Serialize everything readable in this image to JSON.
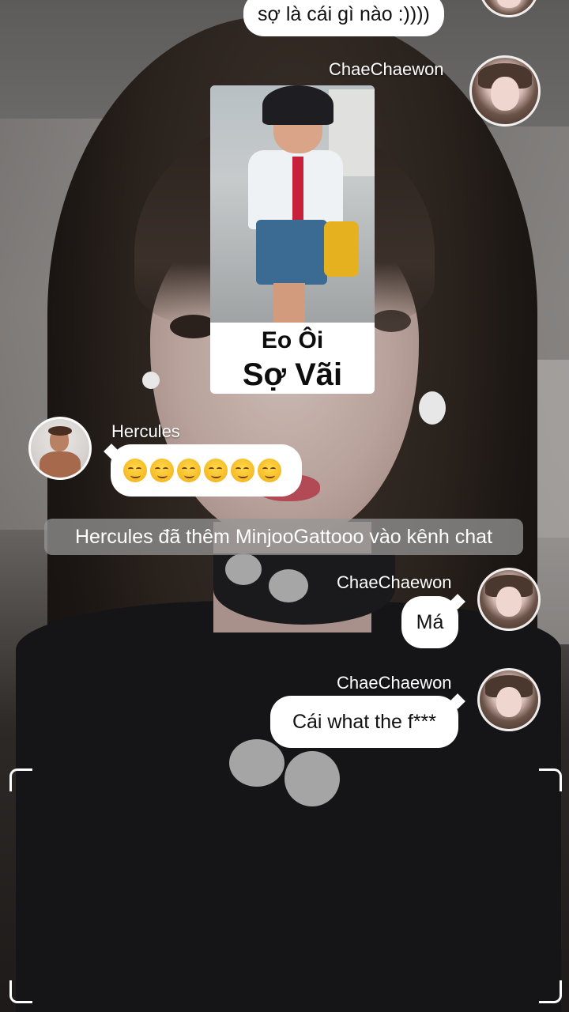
{
  "chat": {
    "top_partial_message": "sợ là cái gì nào :))))",
    "messages": [
      {
        "sender": "ChaeChaewon",
        "sticker_caption_line1": "Eo Ôi",
        "sticker_caption_line2": "Sợ Vãi"
      },
      {
        "sender": "Hercules",
        "text": "😏😏😏😏😏😏"
      },
      {
        "system": "Hercules đã thêm MinjooGattooo vào kênh chat"
      },
      {
        "sender": "ChaeChaewon",
        "text": "Má"
      },
      {
        "sender": "ChaeChaewon",
        "text": "Cái what the f***"
      }
    ]
  },
  "icons": {
    "emoji": "smirking-face-icon",
    "camera_frame": "viewfinder-corner-icon"
  },
  "colors": {
    "bubble": "#ffffff",
    "system_note_bg": "#969696",
    "emoji_yellow": "#f4b620"
  }
}
